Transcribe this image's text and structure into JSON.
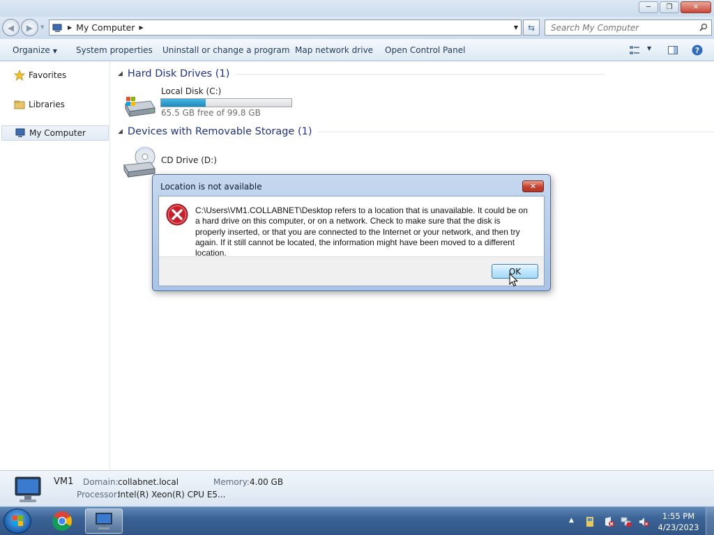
{
  "address": {
    "location": "My Computer",
    "search_placeholder": "Search My Computer"
  },
  "toolbar": {
    "organize": "Organize",
    "system_properties": "System properties",
    "uninstall": "Uninstall or change a program",
    "map_drive": "Map network drive",
    "control_panel": "Open Control Panel"
  },
  "sidebar": {
    "items": [
      {
        "label": "Favorites",
        "icon": "star-icon"
      },
      {
        "label": "Libraries",
        "icon": "folder-icon"
      },
      {
        "label": "My Computer",
        "icon": "computer-icon",
        "selected": true
      }
    ]
  },
  "groups": {
    "hard_disks": {
      "header": "Hard Disk Drives (1)",
      "drive_label": "Local Disk (C:)",
      "free_text": "65.5 GB free of 99.8 GB",
      "used_fraction": 0.34
    },
    "removable": {
      "header": "Devices with Removable Storage (1)",
      "drive_label": "CD Drive (D:)"
    }
  },
  "details": {
    "name": "VM1",
    "domain_label": "Domain:",
    "domain_value": "collabnet.local",
    "memory_label": "Memory:",
    "memory_value": "4.00 GB",
    "processor_label": "Processor:",
    "processor_value": "Intel(R) Xeon(R) CPU E5..."
  },
  "dialog": {
    "title": "Location is not available",
    "message": "C:\\Users\\VM1.COLLABNET\\Desktop refers to a location that is unavailable. It could be on a hard drive on this computer, or on a network. Check to make sure that the disk is properly inserted, or that you are connected to the Internet or your network, and then try again. If it still cannot be located, the information might have been moved to a different location.",
    "ok_label": "OK"
  },
  "taskbar": {
    "time": "1:55 PM",
    "date": "4/23/2023"
  },
  "colors": {
    "accent_bar": "#2a9ad0",
    "header_text": "#1e3287",
    "error_red": "#c8202a"
  }
}
